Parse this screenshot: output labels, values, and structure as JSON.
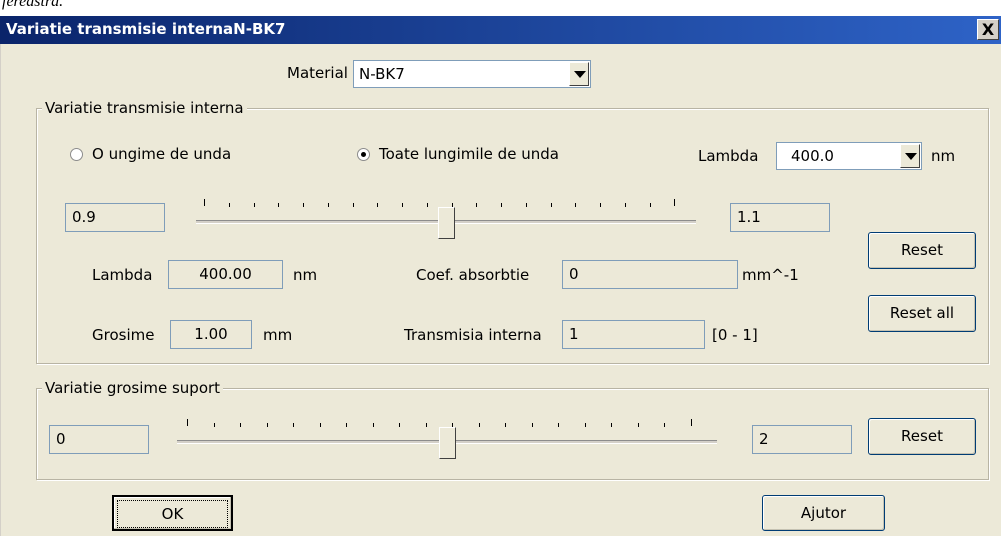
{
  "background_text": "fereastra.",
  "window": {
    "title": "Variatie transmisie internaN-BK7",
    "close_symbol": "X",
    "accent": "#0a246a"
  },
  "material": {
    "label": "Material",
    "value": "N-BK7"
  },
  "group1": {
    "title": "Variatie transmisie interna",
    "radio_single": "O ungime de unda",
    "radio_all": "Toate lungimile de unda",
    "radio_selected": "radio_all",
    "lambda_label": "Lambda",
    "lambda_value": "400.0",
    "lambda_unit": "nm",
    "slider_min": "0.9",
    "slider_max": "1.1",
    "slider_position": 0.5,
    "lambda2_label": "Lambda",
    "lambda2_value": "400.00",
    "lambda2_unit": "nm",
    "coef_label": "Coef. absorbtie",
    "coef_value": "0",
    "coef_unit": "mm^-1",
    "grosime_label": "Grosime",
    "grosime_value": "1.00",
    "grosime_unit": "mm",
    "transmisia_label": "Transmisia interna",
    "transmisia_value": "1",
    "transmisia_range": "[0 - 1]",
    "reset_label": "Reset",
    "reset_all_label": "Reset all"
  },
  "group2": {
    "title": "Variatie grosime suport",
    "slider_min": "0",
    "slider_max": "2",
    "slider_position": 0.5,
    "reset_label": "Reset"
  },
  "footer": {
    "ok_label": "OK",
    "help_label": "Ajutor"
  }
}
